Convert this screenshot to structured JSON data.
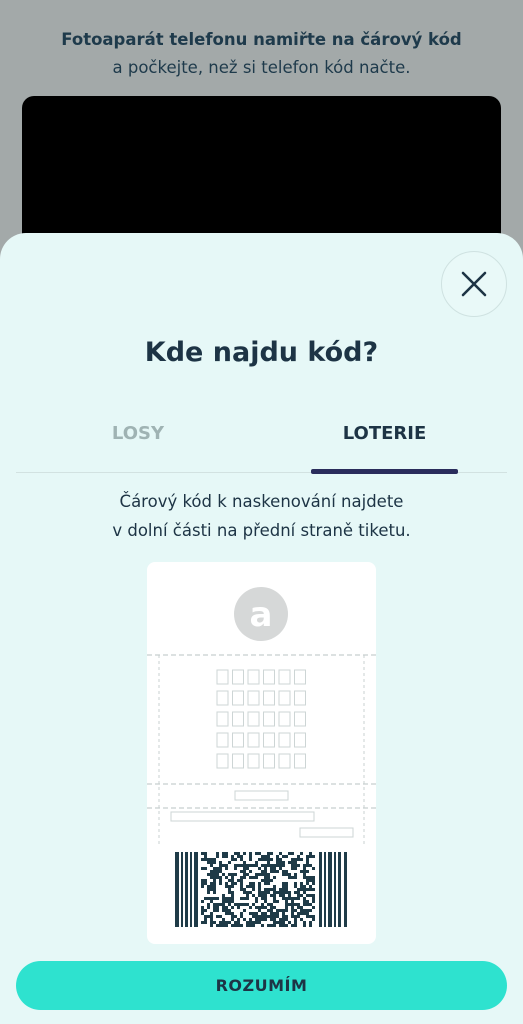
{
  "instructions": {
    "title": "Fotoaparát telefonu namiřte na čárový kód",
    "subtitle": "a počkejte, než si telefon kód načte."
  },
  "sheet": {
    "title": "Kde najdu kód?",
    "tabs": [
      {
        "label": "LOSY",
        "active": false
      },
      {
        "label": "LOTERIE",
        "active": true
      }
    ],
    "description_line1": "Čárový kód k naskenování najdete",
    "description_line2": "v dolní části na přední straně tiketu.",
    "ticket_logo_letter": "a",
    "confirm_label": "ROZUMÍM"
  },
  "icons": {
    "close": "close-icon",
    "logo": "sazka-logo-icon"
  },
  "colors": {
    "overlay": "#a3a9a9",
    "sheet_bg": "#e6f8f7",
    "text_dark": "#1d3445",
    "tab_inactive": "#9fb3b3",
    "tab_underline": "#2a2d5c",
    "accent": "#2ee2cf",
    "barcode": "#1f3b48"
  }
}
